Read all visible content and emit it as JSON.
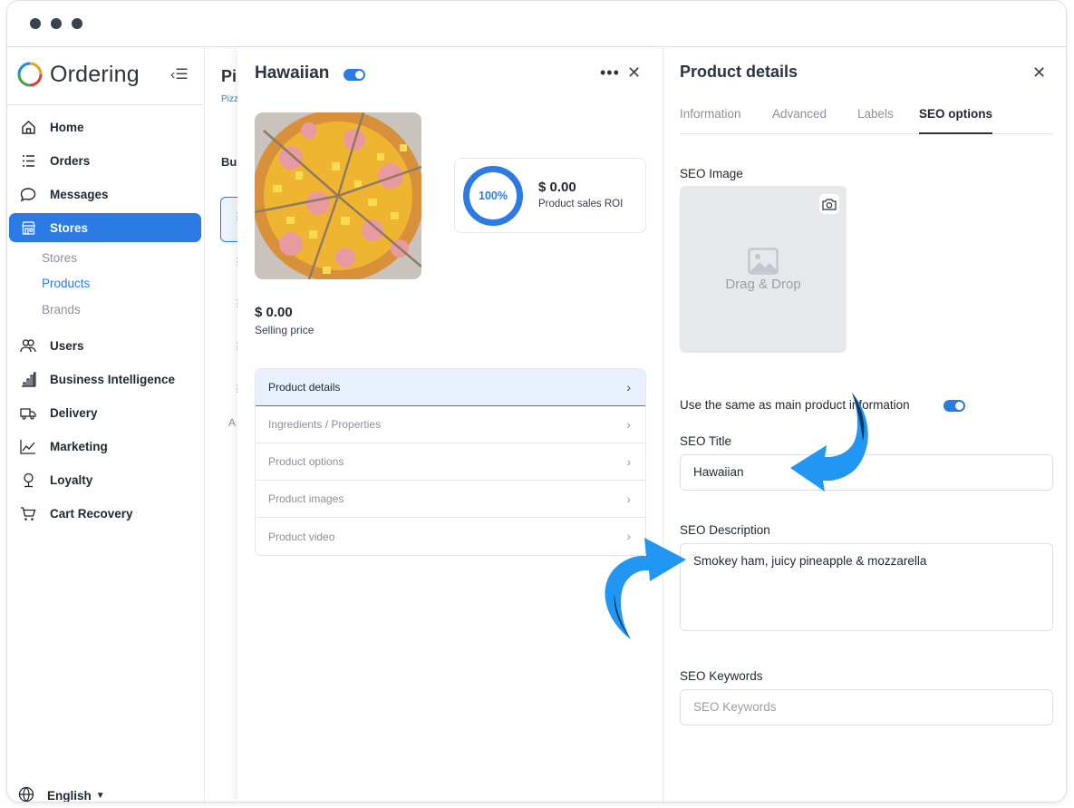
{
  "app": {
    "name": "Ordering"
  },
  "sidebar": {
    "items": [
      {
        "label": "Home",
        "icon": "home-icon"
      },
      {
        "label": "Orders",
        "icon": "list-icon"
      },
      {
        "label": "Messages",
        "icon": "chat-icon"
      },
      {
        "label": "Stores",
        "icon": "store-icon",
        "active": true
      },
      {
        "label": "Users",
        "icon": "users-icon"
      },
      {
        "label": "Business Intelligence",
        "icon": "bar-chart-icon"
      },
      {
        "label": "Delivery",
        "icon": "truck-icon"
      },
      {
        "label": "Marketing",
        "icon": "graph-icon"
      },
      {
        "label": "Loyalty",
        "icon": "award-icon"
      },
      {
        "label": "Cart Recovery",
        "icon": "cart-icon"
      }
    ],
    "subitems": [
      {
        "label": "Stores"
      },
      {
        "label": "Products",
        "active": true
      },
      {
        "label": "Brands"
      }
    ],
    "language": "English"
  },
  "background": {
    "title": "Pi",
    "breadcrumb": "Pizz",
    "section": "Bu",
    "letter": "A"
  },
  "product": {
    "name": "Hawaiian",
    "enabled": true,
    "roi_percent": "100%",
    "roi_value": "$ 0.00",
    "roi_label": "Product sales ROI",
    "price": "$ 0.00",
    "price_label": "Selling price",
    "menu": [
      {
        "label": "Product details",
        "active": true
      },
      {
        "label": "Ingredients / Properties"
      },
      {
        "label": "Product options"
      },
      {
        "label": "Product images"
      },
      {
        "label": "Product video"
      }
    ]
  },
  "details": {
    "title": "Product details",
    "tabs": [
      "Information",
      "Advanced",
      "Labels",
      "SEO options"
    ],
    "active_tab": "SEO options",
    "seo_image_label": "SEO Image",
    "drag_drop": "Drag & Drop",
    "same_as_main": "Use the same as main product information",
    "same_as_main_enabled": true,
    "seo_title_label": "SEO Title",
    "seo_title_value": "Hawaiian",
    "seo_description_label": "SEO Description",
    "seo_description_value": "Smokey ham, juicy pineapple & mozzarella",
    "seo_keywords_label": "SEO Keywords",
    "seo_keywords_placeholder": "SEO Keywords"
  },
  "colors": {
    "accent": "#2c7be5",
    "arrow": "#2196f3",
    "arrow_dark": "#0d3b66"
  }
}
